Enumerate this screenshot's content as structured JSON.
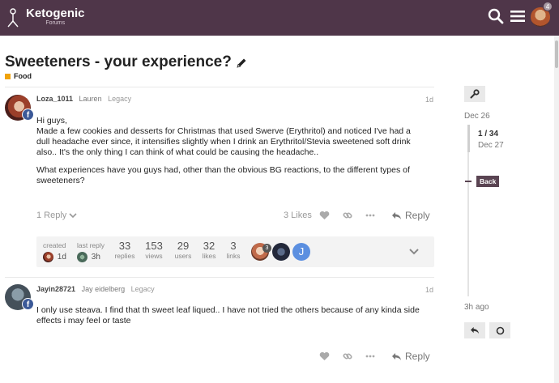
{
  "header": {
    "logo_title": "Ketogenic",
    "logo_subtitle": "Forums",
    "notification_count": "4",
    "icons": [
      "search-icon",
      "hamburger-icon",
      "avatar"
    ]
  },
  "topic": {
    "title": "Sweeteners - your experience?",
    "category": "Food",
    "category_color": "#f0a30a"
  },
  "posts": [
    {
      "username": "Loza_1011",
      "name": "Lauren",
      "group": "Legacy",
      "date": "1d",
      "paragraphs": [
        "Hi guys,\nMade a few cookies and desserts for Christmas that used Swerve (Erythritol) and noticed I've had a dull headache ever since, it intensifies slightly when I drink an Erythritol/Stevia sweetened soft drink also.. It's the only thing I can think of what could be causing the headache..",
        "What experiences have you guys had, other than the obvious BG reactions, to the different types of sweeteners?"
      ],
      "replies_label": "1 Reply",
      "likes_label": "3 Likes",
      "reply_label": "Reply"
    },
    {
      "username": "Jayin28721",
      "name": "Jay eidelberg",
      "group": "Legacy",
      "date": "1d",
      "paragraphs": [
        "I only use steava. I find that th sweet leaf liqued.. I have not tried the others because of any kinda side effects i may feel or taste"
      ],
      "reply_label": "Reply"
    }
  ],
  "summary": {
    "created_label": "created",
    "created_value": "1d",
    "last_reply_label": "last reply",
    "last_reply_value": "3h",
    "stats": [
      {
        "num": "33",
        "label": "replies"
      },
      {
        "num": "153",
        "label": "views"
      },
      {
        "num": "29",
        "label": "users"
      },
      {
        "num": "32",
        "label": "likes"
      },
      {
        "num": "3",
        "label": "links"
      }
    ],
    "user_badge_count": "3",
    "user_letter": "J"
  },
  "timeline": {
    "top_date": "Dec 26",
    "position": "1 / 34",
    "position_date": "Dec 27",
    "back_label": "Back",
    "bottom_label": "3h ago"
  },
  "colors": {
    "header_bg": "#4f3649",
    "facebook": "#3b5998",
    "user_letter_bg": "#5b8fe0"
  }
}
